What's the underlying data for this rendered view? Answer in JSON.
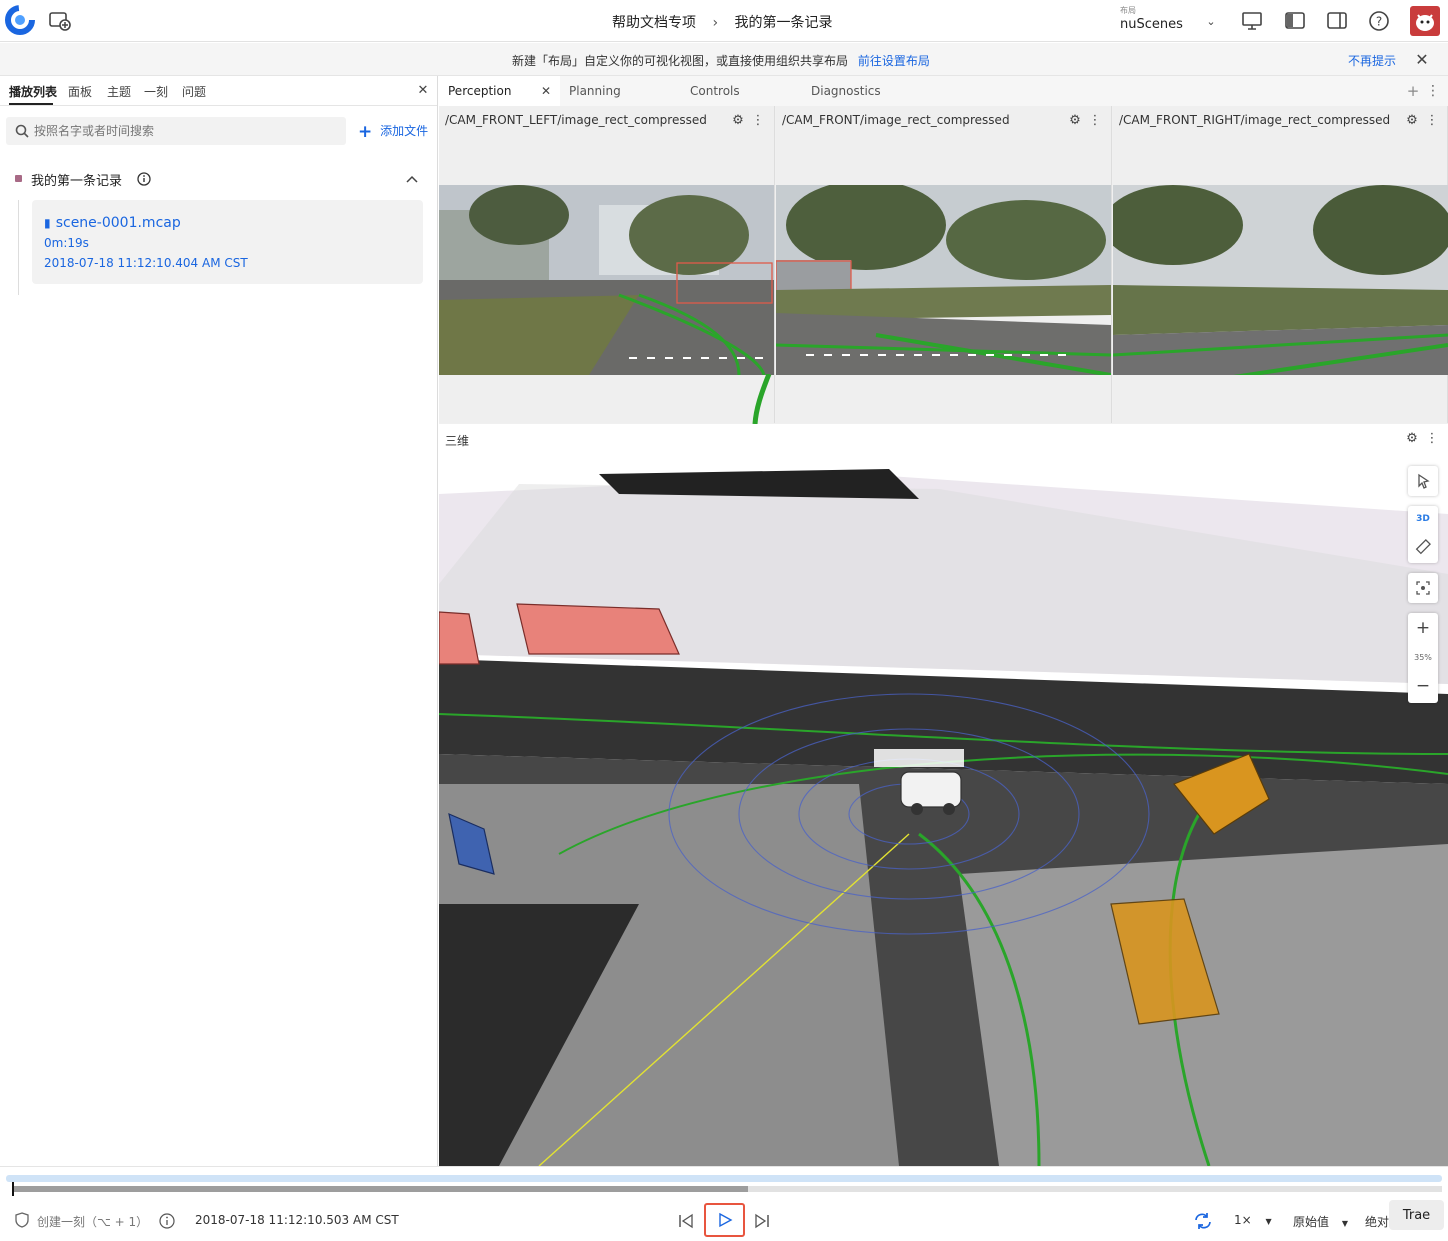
{
  "header": {
    "breadcrumb_parent": "帮助文档专项",
    "breadcrumb_current": "我的第一条记录",
    "layout_label": "布局",
    "layout_value": "nuScenes"
  },
  "banner": {
    "text": "新建「布局」自定义你的可视化视图，或直接使用组织共享布局",
    "link": "前往设置布局",
    "dismiss": "不再提示"
  },
  "sidebar": {
    "tabs": [
      "播放列表",
      "面板",
      "主题",
      "一刻",
      "问题"
    ],
    "search_placeholder": "按照名字或者时间搜索",
    "add_file": "添加文件",
    "record": {
      "title": "我的第一条记录",
      "file": "scene-0001.mcap",
      "duration": "0m:19s",
      "time": "2018-07-18 11:12:10.404 AM CST"
    }
  },
  "layout_tabs": [
    "Perception",
    "Planning",
    "Controls",
    "Diagnostics"
  ],
  "cameras": [
    "/CAM_FRONT_LEFT/image_rect_compressed",
    "/CAM_FRONT/image_rect_compressed",
    "/CAM_FRONT_RIGHT/image_rect_compressed"
  ],
  "panel3d": {
    "title": "三维",
    "mode": "3D",
    "zoom": "35%"
  },
  "playback": {
    "create_moment": "创建一刻（⌥ + 1）",
    "time": "2018-07-18 11:12:10.503 AM CST",
    "speed": "1×",
    "value_mode": "原始值",
    "absolute": "绝对",
    "trace": "Trae",
    "progress": 0.515
  },
  "colors": {
    "accent": "#1a66e0",
    "green": "#2aa52a",
    "box_red": "#e8827a",
    "box_orange": "#d9951f",
    "play_border": "#e8553f"
  }
}
